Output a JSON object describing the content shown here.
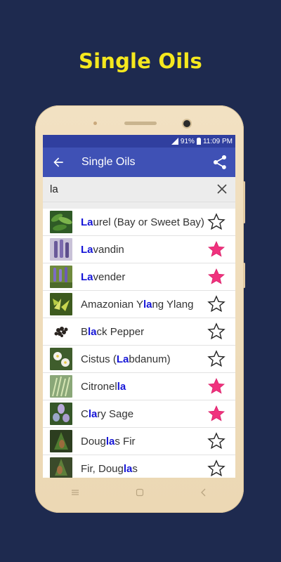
{
  "promo_title": "Single Oils",
  "status": {
    "battery": "91%",
    "time": "11:09 PM"
  },
  "app_bar": {
    "title": "Single Oils"
  },
  "search": {
    "value": "la"
  },
  "oils": [
    {
      "pre": "",
      "match": "La",
      "post": "urel (Bay or Sweet Bay)",
      "favorite": false,
      "thumb": "laurel"
    },
    {
      "pre": "",
      "match": "La",
      "post": "vandin",
      "favorite": true,
      "thumb": "lavandin"
    },
    {
      "pre": "",
      "match": "La",
      "post": "vender",
      "favorite": true,
      "thumb": "lavender"
    },
    {
      "pre": "Amazonian Y",
      "match": "la",
      "post": "ng Ylang",
      "favorite": false,
      "thumb": "ylang"
    },
    {
      "pre": "B",
      "match": "la",
      "post": "ck Pepper",
      "favorite": false,
      "thumb": "pepper"
    },
    {
      "pre": "Cistus (",
      "match": "La",
      "post": "bdanum)",
      "favorite": false,
      "thumb": "cistus"
    },
    {
      "pre": "Citronel",
      "match": "la",
      "post": "",
      "favorite": true,
      "thumb": "citronella"
    },
    {
      "pre": "C",
      "match": "la",
      "post": "ry Sage",
      "favorite": true,
      "thumb": "sage"
    },
    {
      "pre": "Doug",
      "match": "la",
      "post": "s Fir",
      "favorite": false,
      "thumb": "fir"
    },
    {
      "pre": "Fir, Doug",
      "match": "la",
      "post": "s",
      "favorite": false,
      "thumb": "fir2"
    }
  ],
  "icons": {
    "back": "arrow-back-icon",
    "share": "share-icon",
    "clear": "close-icon",
    "favorite_on": "star-filled-icon",
    "favorite_off": "star-outline-icon"
  },
  "colors": {
    "background": "#1e2a4f",
    "promo_title": "#f5e81e",
    "app_bar": "#3f51b5",
    "status_bar": "#303f9f",
    "match_highlight": "#1515d8",
    "star_filled": "#f0327e"
  }
}
